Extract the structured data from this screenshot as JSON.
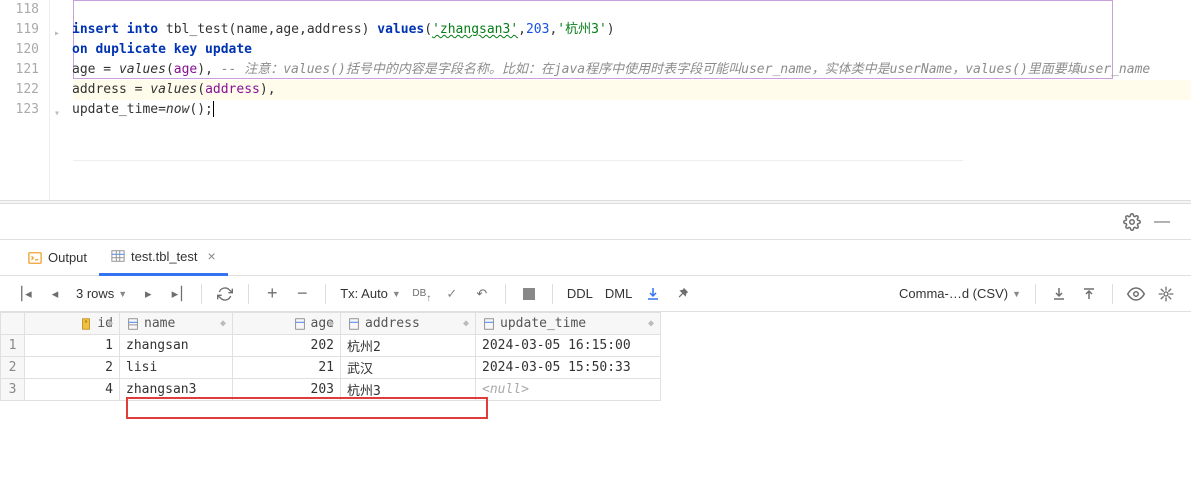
{
  "editor": {
    "line_numbers": [
      "118",
      "119",
      "120",
      "121",
      "122",
      "123"
    ],
    "code": {
      "l119_insert": "insert into",
      "l119_tbl": " tbl_test(",
      "l119_cols": "name,age,address",
      "l119_vals": ") ",
      "l119_values_kw": "values",
      "l119_p1": "(",
      "l119_str1": "'zhangsan3'",
      "l119_c1": ",",
      "l119_num1": "203",
      "l119_c2": ",",
      "l119_str2": "'杭州3'",
      "l119_p2": ")",
      "l120": "on duplicate key update",
      "l121_age": "age",
      "l121_eq": " = ",
      "l121_fn": "values",
      "l121_p1": "(",
      "l121_arg": "age",
      "l121_p2": "), ",
      "l121_cmt": "-- 注意：values()括号中的内容是字段名称。比如：在java程序中使用时表字段可能叫user_name，实体类中是userName，values()里面要填user_name",
      "l122_addr": "address",
      "l122_eq": " = ",
      "l122_fn": "values",
      "l122_p1": "(",
      "l122_arg": "address",
      "l122_p2": "),",
      "l123_ut": "update_time",
      "l123_eq": "=",
      "l123_fn": "now",
      "l123_p": "();"
    }
  },
  "tabs": {
    "output": "Output",
    "grid": "test.tbl_test"
  },
  "toolbar": {
    "rows": "3 rows",
    "tx": "Tx: Auto",
    "db": "DB",
    "ddl": "DDL",
    "dml": "DML",
    "export_fmt": "Comma-…d (CSV)"
  },
  "grid": {
    "headers": {
      "id": "id",
      "name": "name",
      "age": "age",
      "address": "address",
      "update_time": "update_time"
    },
    "rows": [
      {
        "n": "1",
        "id": "1",
        "name": "zhangsan",
        "age": "202",
        "addr": "杭州2",
        "ut": "2024-03-05 16:15:00"
      },
      {
        "n": "2",
        "id": "2",
        "name": "lisi",
        "age": "21",
        "addr": "武汉",
        "ut": "2024-03-05 15:50:33"
      },
      {
        "n": "3",
        "id": "4",
        "name": "zhangsan3",
        "age": "203",
        "addr": "杭州3",
        "ut": "<null>"
      }
    ]
  }
}
